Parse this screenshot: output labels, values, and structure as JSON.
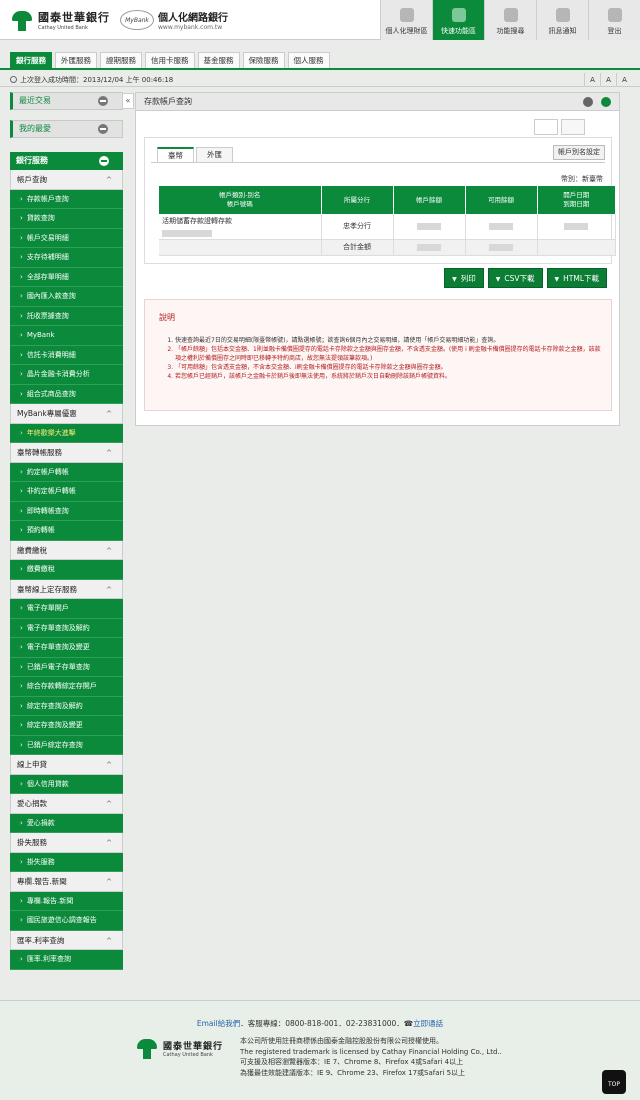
{
  "header": {
    "logo_zh": "國泰世華銀行",
    "logo_en": "Cathay United Bank",
    "mybank_badge": "MyBank",
    "mybank_zh": "個人化網路銀行",
    "mybank_url": "www.mybank.com.tw",
    "nav": [
      "個人化理財區",
      "快速功能區",
      "功能搜尋",
      "訊息通知",
      "登出"
    ]
  },
  "main_tabs": [
    "銀行服務",
    "外匯服務",
    "證期服務",
    "信用卡服務",
    "基金服務",
    "保險服務",
    "個人服務"
  ],
  "login_info": "上次登入成功時間：2013/12/04 上午 00:46:18",
  "font_sizes": [
    "A",
    "A",
    "A"
  ],
  "sidebar": {
    "recent": "最近交易",
    "favorites": "我的最愛",
    "toggle_icon": "«",
    "service_header": "銀行服務",
    "groups": [
      {
        "title": "帳戶查詢",
        "items": [
          "存款帳戶查詢",
          "貸款查詢",
          "帳戶交易明細",
          "支存待補明細",
          "全部存單明細",
          "國內匯入款查詢",
          "託收票據查詢",
          "MyBank",
          "信託卡消費明細",
          "晶片金融卡消費分析",
          "組合式商品查詢"
        ]
      },
      {
        "title": "MyBank專屬優惠",
        "items": [
          "年終歡樂大進擊"
        ]
      },
      {
        "title": "臺幣轉帳服務",
        "items": [
          "約定帳戶轉帳",
          "非約定帳戶轉帳",
          "即時轉帳查詢",
          "預約轉帳"
        ]
      },
      {
        "title": "繳費繳稅",
        "items": [
          "繳費繳稅"
        ]
      },
      {
        "title": "臺幣線上定存服務",
        "items": [
          "電子存單開戶",
          "電子存單查詢及解約",
          "電子存單查詢及變更",
          "已銷戶電子存單查詢",
          "綜合存款轉綜定存開戶",
          "綜定存查詢及解約",
          "綜定存查詢及變更",
          "已銷戶綜定存查詢"
        ]
      },
      {
        "title": "線上申貸",
        "items": [
          "個人信用貸款"
        ]
      },
      {
        "title": "愛心捐款",
        "items": [
          "愛心捐款"
        ]
      },
      {
        "title": "掛失服務",
        "items": [
          "掛失服務"
        ]
      },
      {
        "title": "專欄.報告.新聞",
        "items": [
          "專欄.報告.新聞",
          "國民旅遊信心調查報告"
        ]
      },
      {
        "title": "匯率.利率查詢",
        "items": [
          "匯率.利率查詢"
        ]
      }
    ]
  },
  "content": {
    "title": "存款帳戶查詢",
    "tabs": [
      "臺幣",
      "外匯"
    ],
    "alias_btn": "帳戶別名設定",
    "currency": "幣別：新臺幣",
    "columns": [
      "帳戶類別-別名\n帳戶號碼",
      "所屬分行",
      "帳戶餘額",
      "可用餘額",
      "開戶日期\n到期日期"
    ],
    "row": {
      "type": "活期儲蓄存款證轉存款",
      "branch": "忠孝分行"
    },
    "total_label": "合計金額",
    "buttons": [
      "列印",
      "CSV下載",
      "HTML下載"
    ],
    "notes_title": "說明",
    "notes": [
      {
        "text": "快速查詢最近7日的交易明細(限臺幣帳號)，請點選帳號；欲查詢6個月內之交易明細，請使用「帳戶交易明細功能」查詢。",
        "red": false
      },
      {
        "text": "「帳戶餘額」包括本交金額、1則並融卡備償圈提存的電話卡存除款之金額與圈存金額，不含透支金額。(使用 i 刷金融卡備償圈提存的電話卡存除款之金額，該款項之權利於備償圈存之同時即已移轉予特約商店，故您無法提領該筆款項。)",
        "red": true
      },
      {
        "text": "「可用餘額」包含透支金額，不含本交金額、i刷金融卡備償圈提存的電話卡存除款之金額與圈存金額。",
        "red": true
      },
      {
        "text": "若您帳戶已經銷戶，該帳戶之金融卡於銷戶後即無法使用，系統將於銷戶次日自動刪除該銷戶帳號資料。",
        "red": true
      }
    ]
  },
  "footer": {
    "contact_email": "Email給我們",
    "contact_rest": "．客服專線：0800-818-001．02-23831000．",
    "contact_link": "立即通話",
    "lines": [
      "本公司所使用註冊商標係由國泰金融控股股份有限公司授權使用。",
      "The registered trademark is licensed by Cathay Financial Holding Co., Ltd..",
      "可支援及相容瀏覽器版本：IE 7、Chrome 8、Firefox 4或Safari 4以上",
      "為獲最佳效能建議版本：IE 9、Chrome 23、Firefox 17或Safari 5以上"
    ],
    "top": "TOP"
  }
}
